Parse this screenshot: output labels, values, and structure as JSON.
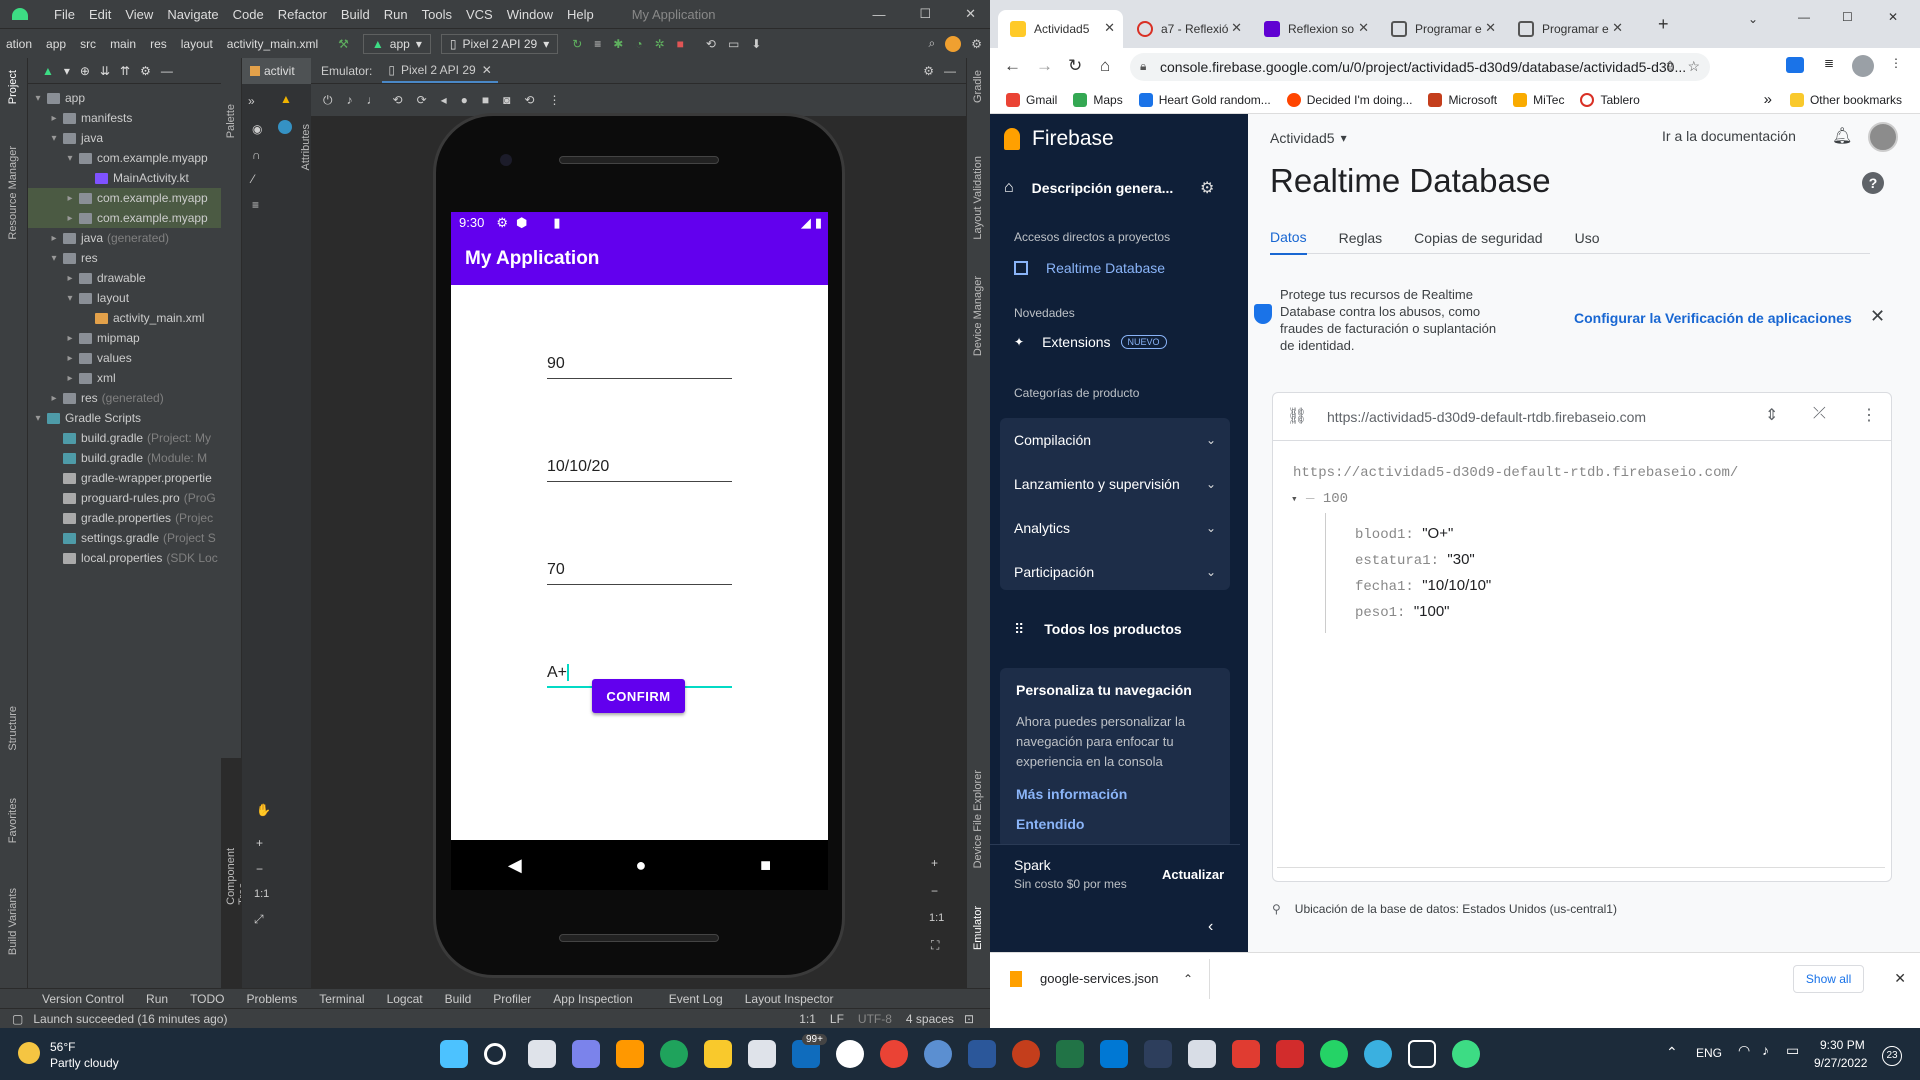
{
  "android_studio": {
    "menu": [
      "ation",
      "File",
      "Edit",
      "View",
      "Navigate",
      "Code",
      "Refactor",
      "Build",
      "Run",
      "Tools",
      "VCS",
      "Window",
      "Help"
    ],
    "window_title": "My Application",
    "breadcrumb": [
      "ation",
      "app",
      "src",
      "main",
      "res",
      "layout",
      "activity_main.xml"
    ],
    "run_config": "app",
    "device": "Pixel 2 API 29",
    "left_strip_labels": [
      "Project",
      "Resource Manager",
      "Structure",
      "Favorites",
      "Build Variants"
    ],
    "right_strip_labels": [
      "Gradle",
      "Layout Validation",
      "Device Manager",
      "Device File Explorer",
      "Emulator"
    ],
    "editor_tab": "activit",
    "emulator_label": "Emulator:",
    "emulator_tab": "Pixel 2 API 29",
    "palette_label": "Palette",
    "attributes_label": "Attributes",
    "component_tree_label": "Component Tree",
    "zoom_ratio": "1:1",
    "tree": [
      {
        "label": "app",
        "indent": 0,
        "arrow": "▾",
        "icon": "folder",
        "dim": ""
      },
      {
        "label": "manifests",
        "indent": 1,
        "arrow": "▸",
        "icon": "folder",
        "dim": ""
      },
      {
        "label": "java",
        "indent": 1,
        "arrow": "▾",
        "icon": "folder",
        "dim": ""
      },
      {
        "label": "com.example.myapp",
        "indent": 2,
        "arrow": "▾",
        "icon": "folder",
        "dim": ""
      },
      {
        "label": "MainActivity.kt",
        "indent": 3,
        "arrow": "",
        "icon": "kt",
        "dim": ""
      },
      {
        "label": "com.example.myapp",
        "indent": 2,
        "arrow": "▸",
        "icon": "folder",
        "dim": "",
        "sel": true
      },
      {
        "label": "com.example.myapp",
        "indent": 2,
        "arrow": "▸",
        "icon": "folder",
        "dim": "",
        "sel": true
      },
      {
        "label": "java",
        "indent": 1,
        "arrow": "▸",
        "icon": "folder",
        "dim": "(generated)"
      },
      {
        "label": "res",
        "indent": 1,
        "arrow": "▾",
        "icon": "folder",
        "dim": ""
      },
      {
        "label": "drawable",
        "indent": 2,
        "arrow": "▸",
        "icon": "folder",
        "dim": ""
      },
      {
        "label": "layout",
        "indent": 2,
        "arrow": "▾",
        "icon": "folder",
        "dim": ""
      },
      {
        "label": "activity_main.xml",
        "indent": 3,
        "arrow": "",
        "icon": "xml",
        "dim": ""
      },
      {
        "label": "mipmap",
        "indent": 2,
        "arrow": "▸",
        "icon": "folder",
        "dim": ""
      },
      {
        "label": "values",
        "indent": 2,
        "arrow": "▸",
        "icon": "folder",
        "dim": ""
      },
      {
        "label": "xml",
        "indent": 2,
        "arrow": "▸",
        "icon": "folder",
        "dim": ""
      },
      {
        "label": "res",
        "indent": 1,
        "arrow": "▸",
        "icon": "folder",
        "dim": "(generated)"
      },
      {
        "label": "Gradle Scripts",
        "indent": 0,
        "arrow": "▾",
        "icon": "gr",
        "dim": ""
      },
      {
        "label": "build.gradle",
        "indent": 1,
        "arrow": "",
        "icon": "gr",
        "dim": "(Project: My"
      },
      {
        "label": "build.gradle",
        "indent": 1,
        "arrow": "",
        "icon": "gr",
        "dim": "(Module: M"
      },
      {
        "label": "gradle-wrapper.propertie",
        "indent": 1,
        "arrow": "",
        "icon": "file",
        "dim": ""
      },
      {
        "label": "proguard-rules.pro",
        "indent": 1,
        "arrow": "",
        "icon": "file",
        "dim": "(ProG"
      },
      {
        "label": "gradle.properties",
        "indent": 1,
        "arrow": "",
        "icon": "file",
        "dim": "(Projec"
      },
      {
        "label": "settings.gradle",
        "indent": 1,
        "arrow": "",
        "icon": "gr",
        "dim": "(Project S"
      },
      {
        "label": "local.properties",
        "indent": 1,
        "arrow": "",
        "icon": "file",
        "dim": "(SDK Loc"
      }
    ],
    "bottom_tools": [
      "Version Control",
      "Run",
      "TODO",
      "Problems",
      "Terminal",
      "Logcat",
      "Build",
      "Profiler",
      "App Inspection",
      "Event Log",
      "Layout Inspector"
    ],
    "status": "Launch succeeded (16 minutes ago)",
    "status_right": [
      "1:1",
      "LF",
      "UTF-8",
      "4 spaces"
    ]
  },
  "phone": {
    "time": "9:30",
    "app_title": "My Application",
    "fields": [
      "90",
      "10/10/20",
      "70",
      "A+"
    ],
    "confirm_label": "CONFIRM"
  },
  "chrome": {
    "tabs": [
      "Actividad5",
      "a7 - Reflexió",
      "Reflexion so",
      "Programar e",
      "Programar e"
    ],
    "url": "console.firebase.google.com/u/0/project/actividad5-d30d9/database/actividad5-d30...",
    "bookmarks": [
      "Gmail",
      "Maps",
      "Heart Gold random...",
      "Decided I'm doing...",
      "Microsoft",
      "MiTec",
      "Tablero"
    ],
    "other_bookmarks": "Other bookmarks",
    "more": "»"
  },
  "firebase": {
    "brand": "Firebase",
    "project_overview": "Descripción genera...",
    "shortcuts_header": "Accesos directos a proyectos",
    "realtime_db_link": "Realtime Database",
    "news_header": "Novedades",
    "extensions": "Extensions",
    "new_badge": "NUEVO",
    "categories_header": "Categorías de producto",
    "categories": [
      "Compilación",
      "Lanzamiento y supervisión",
      "Analytics",
      "Participación"
    ],
    "all_products": "Todos los productos",
    "personalize_title": "Personaliza tu navegación",
    "personalize_body": "Ahora puedes personalizar la navegación para enfocar tu experiencia en la consola",
    "more_info": "Más información",
    "understood": "Entendido",
    "plan": "Spark",
    "plan_price": "Sin costo $0 por mes",
    "upgrade": "Actualizar",
    "project_name": "Actividad5",
    "docs_link": "Ir a la documentación",
    "page_title": "Realtime Database",
    "tabs": [
      "Datos",
      "Reglas",
      "Copias de seguridad",
      "Uso"
    ],
    "banner_text": "Protege tus recursos de Realtime Database contra los abusos, como fraudes de facturación o suplantación de identidad.",
    "banner_link": "Configurar la Verificación de aplicaciones",
    "db_url": "https://actividad5-d30d9-default-rtdb.firebaseio.com",
    "root_url": "https://actividad5-d30d9-default-rtdb.firebaseio.com/",
    "node_key": "100",
    "entries": [
      {
        "key": "blood1: ",
        "value": "\"O+\""
      },
      {
        "key": "estatura1: ",
        "value": "\"30\""
      },
      {
        "key": "fecha1: ",
        "value": "\"10/10/10\""
      },
      {
        "key": "peso1: ",
        "value": "\"100\""
      }
    ],
    "location": "Ubicación de la base de datos: Estados Unidos (us-central1)"
  },
  "download": {
    "file": "google-services.json",
    "show_all": "Show all"
  },
  "taskbar": {
    "temp": "56°F",
    "weather": "Partly cloudy",
    "badge": "99+",
    "lang": "ENG",
    "time": "9:30 PM",
    "date": "9/27/2022",
    "notif": "23"
  }
}
